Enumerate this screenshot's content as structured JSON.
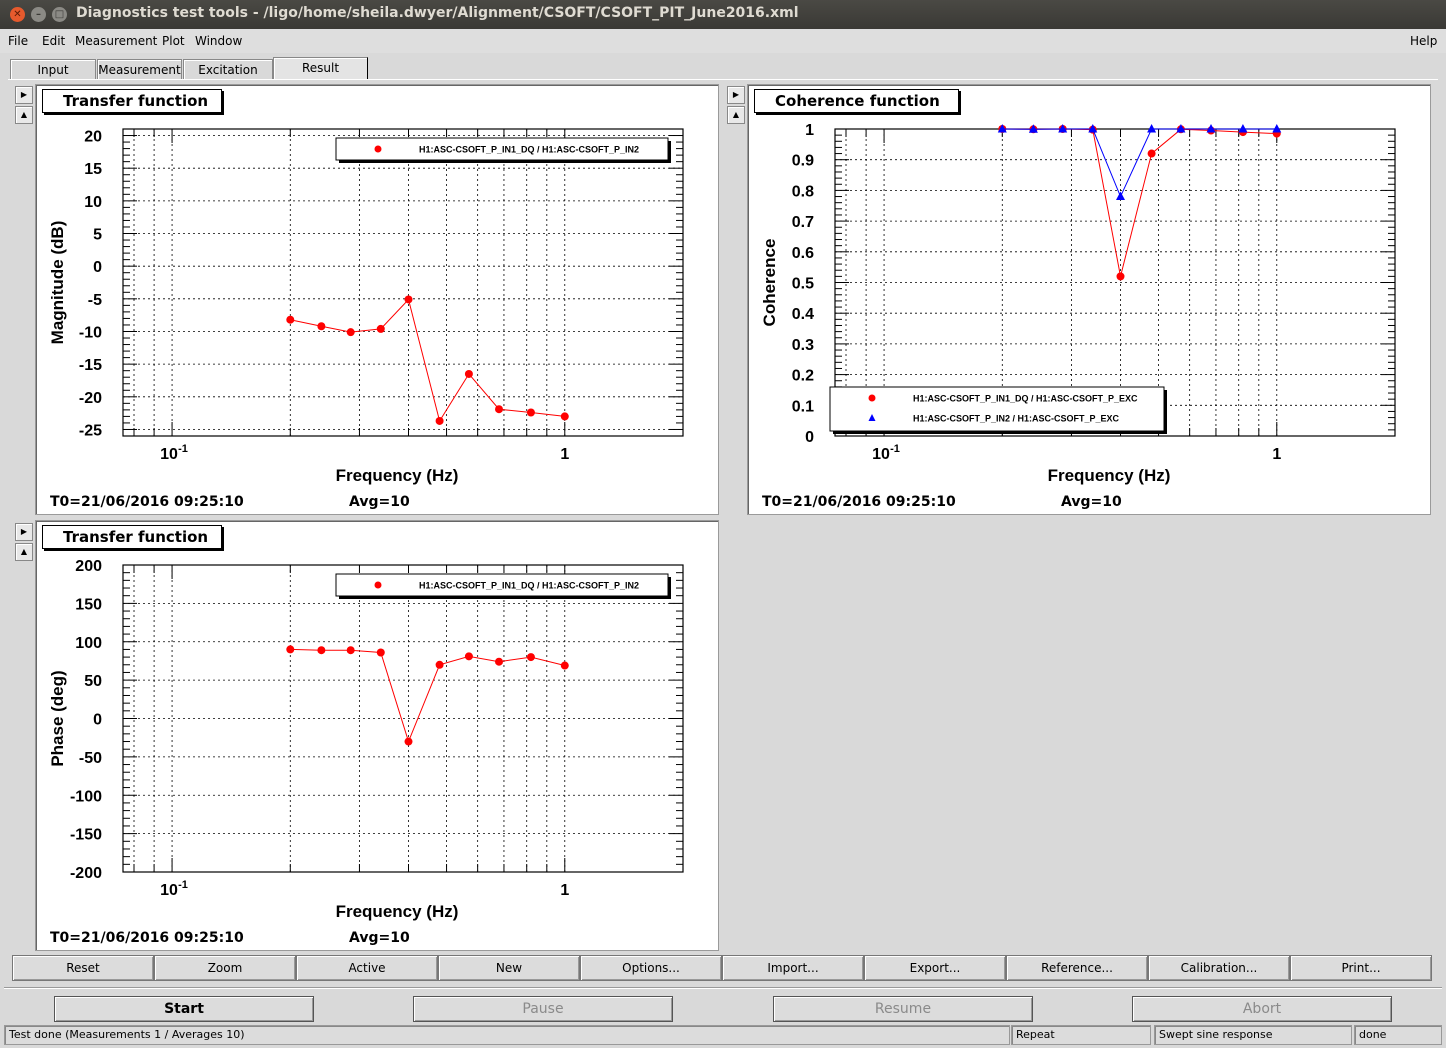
{
  "window": {
    "title": "Diagnostics test tools - /ligo/home/sheila.dwyer/Alignment/CSOFT/CSOFT_PIT_June2016.xml"
  },
  "menu": {
    "file": "File",
    "edit": "Edit",
    "measurement": "Measurement",
    "plot": "Plot",
    "window": "Window",
    "help": "Help"
  },
  "tabs": [
    "Input",
    "Measurement",
    "Excitation",
    "Result"
  ],
  "active_tab": "Result",
  "panels": {
    "magnitude": {
      "title": "Transfer function",
      "t0": "T0=21/06/2016 09:25:10",
      "avg": "Avg=10"
    },
    "coherence": {
      "title": "Coherence function",
      "t0": "T0=21/06/2016 09:25:10",
      "avg": "Avg=10"
    },
    "phase": {
      "title": "Transfer function",
      "t0": "T0=21/06/2016 09:25:10",
      "avg": "Avg=10"
    }
  },
  "chart_data": [
    {
      "type": "scatter",
      "xscale": "log",
      "xlabel": "Frequency (Hz)",
      "ylabel": "Magnitude (dB)",
      "xlim": [
        0.075,
        2.0
      ],
      "ylim": [
        -26,
        21
      ],
      "yticks": [
        20,
        15,
        10,
        5,
        0,
        -5,
        -10,
        -15,
        -20,
        -25
      ],
      "xtick_labels": [
        "10",
        "1"
      ],
      "grid": true,
      "legend": "top-right",
      "series": [
        {
          "name": "H1:ASC-CSOFT_P_IN1_DQ / H1:ASC-CSOFT_P_IN2",
          "color": "#ff0000",
          "marker": "circle",
          "x": [
            0.2,
            0.24,
            0.285,
            0.34,
            0.4,
            0.48,
            0.57,
            0.68,
            0.82,
            1.0
          ],
          "y": [
            -8.2,
            -9.2,
            -10.1,
            -9.6,
            -5.1,
            -23.7,
            -16.5,
            -21.9,
            -22.4,
            -23.0
          ]
        }
      ]
    },
    {
      "type": "scatter",
      "xscale": "log",
      "xlabel": "Frequency (Hz)",
      "ylabel": "Coherence",
      "xlim": [
        0.075,
        2.0
      ],
      "ylim": [
        0,
        1
      ],
      "yticks": [
        1,
        0.9,
        0.8,
        0.7,
        0.6,
        0.5,
        0.4,
        0.3,
        0.2,
        0.1,
        0
      ],
      "xtick_labels": [
        "10",
        "1"
      ],
      "grid": true,
      "legend": "bottom-left",
      "series": [
        {
          "name": "H1:ASC-CSOFT_P_IN1_DQ / H1:ASC-CSOFT_P_EXC",
          "color": "#ff0000",
          "marker": "circle",
          "x": [
            0.2,
            0.24,
            0.285,
            0.34,
            0.4,
            0.48,
            0.57,
            0.68,
            0.82,
            1.0
          ],
          "y": [
            1.0,
            0.999,
            1.0,
            0.998,
            0.52,
            0.92,
            0.999,
            0.995,
            0.99,
            0.985
          ]
        },
        {
          "name": "H1:ASC-CSOFT_P_IN2 / H1:ASC-CSOFT_P_EXC",
          "color": "#0000ff",
          "marker": "triangle",
          "x": [
            0.2,
            0.24,
            0.285,
            0.34,
            0.4,
            0.48,
            0.57,
            0.68,
            0.82,
            1.0
          ],
          "y": [
            1.0,
            0.999,
            1.0,
            1.0,
            0.78,
            1.0,
            1.0,
            1.0,
            1.0,
            1.0
          ]
        }
      ]
    },
    {
      "type": "scatter",
      "xscale": "log",
      "xlabel": "Frequency (Hz)",
      "ylabel": "Phase (deg)",
      "xlim": [
        0.075,
        2.0
      ],
      "ylim": [
        -200,
        200
      ],
      "yticks": [
        200,
        150,
        100,
        50,
        0,
        -50,
        -100,
        -150,
        -200
      ],
      "xtick_labels": [
        "10",
        "1"
      ],
      "grid": true,
      "legend": "top-right",
      "series": [
        {
          "name": "H1:ASC-CSOFT_P_IN1_DQ / H1:ASC-CSOFT_P_IN2",
          "color": "#ff0000",
          "marker": "circle",
          "x": [
            0.2,
            0.24,
            0.285,
            0.34,
            0.4,
            0.48,
            0.57,
            0.68,
            0.82,
            1.0
          ],
          "y": [
            90,
            89,
            89,
            86,
            -30,
            70,
            81,
            74,
            80,
            69
          ]
        }
      ]
    }
  ],
  "toolbar": [
    "Reset",
    "Zoom",
    "Active",
    "New",
    "Options...",
    "Import...",
    "Export...",
    "Reference...",
    "Calibration...",
    "Print..."
  ],
  "controls": {
    "start": "Start",
    "pause": "Pause",
    "resume": "Resume",
    "abort": "Abort"
  },
  "status": {
    "message": "Test done (Measurements 1 / Averages 10)",
    "mode": "Repeat",
    "type": "Swept sine response",
    "state": "done"
  }
}
